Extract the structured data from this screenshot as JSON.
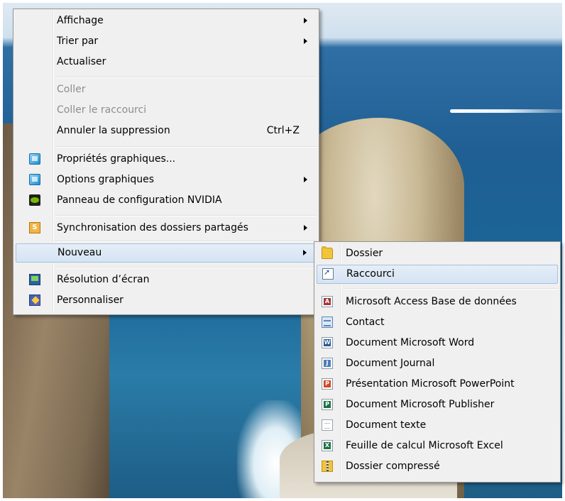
{
  "context_menu": {
    "items": [
      {
        "label": "Affichage",
        "submenu": true
      },
      {
        "label": "Trier par",
        "submenu": true
      },
      {
        "label": "Actualiser"
      },
      {
        "label": "Coller",
        "disabled": true
      },
      {
        "label": "Coller le raccourci",
        "disabled": true
      },
      {
        "label": "Annuler la suppression",
        "shortcut": "Ctrl+Z"
      },
      {
        "label": "Propriétés graphiques...",
        "icon": "graphics-properties-icon"
      },
      {
        "label": "Options graphiques",
        "icon": "graphics-options-icon",
        "submenu": true
      },
      {
        "label": "Panneau de configuration NVIDIA",
        "icon": "nvidia-icon"
      },
      {
        "label": "Synchronisation des dossiers partagés",
        "icon": "sync-folders-icon",
        "submenu": true
      },
      {
        "label": "Nouveau",
        "submenu": true,
        "highlighted": true
      },
      {
        "label": "Résolution d’écran",
        "icon": "screen-resolution-icon"
      },
      {
        "label": "Personnaliser",
        "icon": "personalize-icon"
      }
    ]
  },
  "new_submenu": {
    "items": [
      {
        "label": "Dossier",
        "icon": "folder-icon"
      },
      {
        "label": "Raccourci",
        "icon": "shortcut-icon",
        "highlighted": true
      },
      {
        "label": "Microsoft Access Base de données",
        "icon": "access-icon"
      },
      {
        "label": "Contact",
        "icon": "contact-icon"
      },
      {
        "label": "Document Microsoft Word",
        "icon": "word-icon"
      },
      {
        "label": "Document Journal",
        "icon": "journal-icon"
      },
      {
        "label": "Présentation Microsoft PowerPoint",
        "icon": "powerpoint-icon"
      },
      {
        "label": "Document Microsoft Publisher",
        "icon": "publisher-icon"
      },
      {
        "label": "Document texte",
        "icon": "text-document-icon"
      },
      {
        "label": "Feuille de calcul Microsoft Excel",
        "icon": "excel-icon"
      },
      {
        "label": "Dossier compressé",
        "icon": "zip-folder-icon"
      }
    ]
  },
  "colors": {
    "menu_background": "#f0f0f0",
    "highlight": "#d5e3f3",
    "highlight_border": "#a7c1dd",
    "disabled_text": "#8d8d8d"
  }
}
